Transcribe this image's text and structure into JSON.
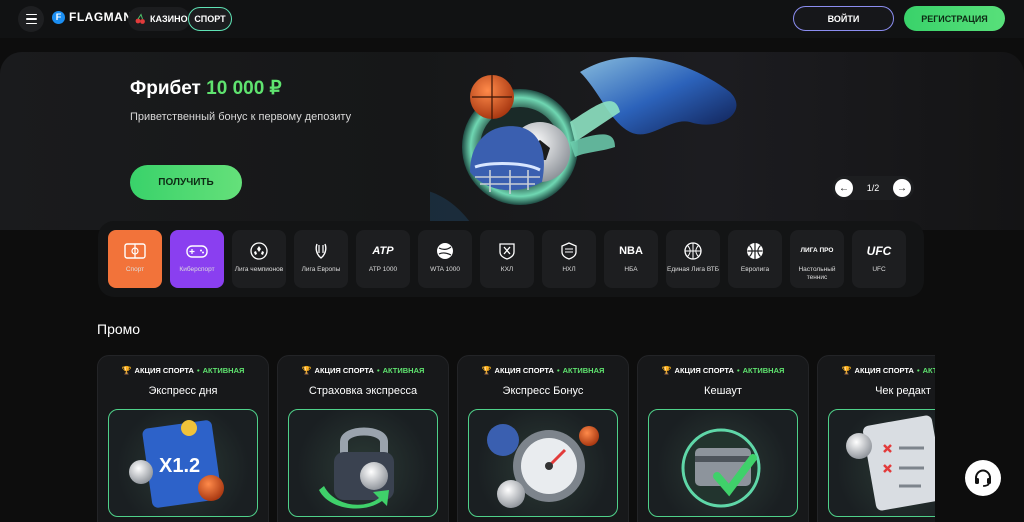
{
  "header": {
    "menu_icon": "hamburger-icon",
    "logo_text": "FLAGMAN",
    "logo_letter": "F",
    "casino_label": "КАЗИНО",
    "sport_label": "СПОРТ",
    "login_label": "ВОЙТИ",
    "register_label": "РЕГИСТРАЦИЯ"
  },
  "banner": {
    "title_prefix": "Фрибет",
    "title_amount": "10 000 ₽",
    "subtitle": "Приветственный бонус к первому депозиту",
    "cta_label": "ПОЛУЧИТЬ",
    "pager": "1/2"
  },
  "categories": [
    {
      "label": "Спорт",
      "icon": "soccer-field-icon"
    },
    {
      "label": "Киберспорт",
      "icon": "gamepad-icon"
    },
    {
      "label": "Лига чемпионов",
      "icon": "champions-league-icon"
    },
    {
      "label": "Лига Европы",
      "icon": "europa-league-icon"
    },
    {
      "label": "ATP 1000",
      "icon": "atp-icon",
      "icon_text": "ATP"
    },
    {
      "label": "WTA 1000",
      "icon": "wta-icon"
    },
    {
      "label": "КХЛ",
      "icon": "khl-icon"
    },
    {
      "label": "НХЛ",
      "icon": "nhl-icon"
    },
    {
      "label": "НБА",
      "icon": "nba-icon",
      "icon_text": "NBA"
    },
    {
      "label": "Единая Лига ВТБ",
      "icon": "vtb-league-icon"
    },
    {
      "label": "Евролига",
      "icon": "euroleague-icon"
    },
    {
      "label": "Настольный теннис",
      "icon": "table-tennis-icon",
      "icon_text": "ЛИГА ПРО"
    },
    {
      "label": "UFC",
      "icon": "ufc-icon",
      "icon_text": "UFC"
    }
  ],
  "promo": {
    "title": "Промо",
    "tag": "АКЦИЯ СПОРТА",
    "dot": "•",
    "status": "АКТИВНАЯ",
    "cards": [
      {
        "title": "Экспресс дня"
      },
      {
        "title": "Страховка экспресса"
      },
      {
        "title": "Экспресс Бонус"
      },
      {
        "title": "Кешаут"
      },
      {
        "title": "Чек редакт"
      }
    ],
    "card1_image_text": "X1.2"
  },
  "support_icon": "headset-icon",
  "colors": {
    "accent_green": "#5fe36f",
    "sport_orange": "#f2733a",
    "esport_purple": "#8a3ff0",
    "login_border": "#8b8df0"
  }
}
